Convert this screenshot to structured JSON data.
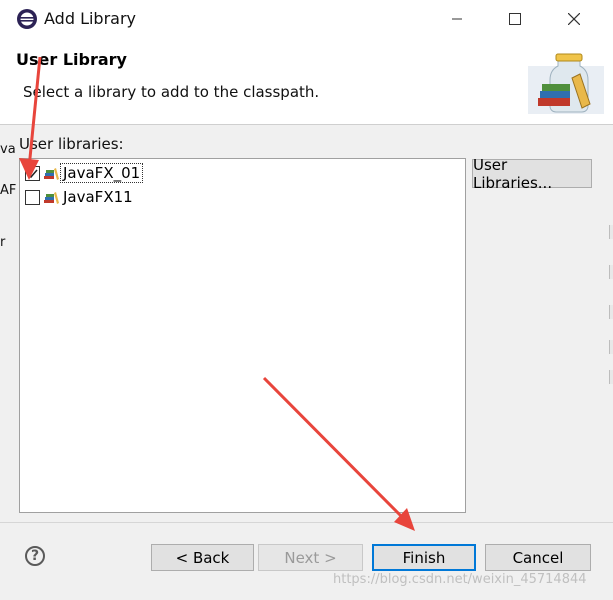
{
  "window": {
    "title": "Add Library",
    "minimize_icon": "minimize-icon",
    "maximize_icon": "maximize-icon",
    "close_icon": "close-icon"
  },
  "header": {
    "title": "User Library",
    "message": "Select a library to add to the classpath."
  },
  "list": {
    "label": "User libraries:",
    "items": [
      {
        "label": "JavaFX_01",
        "checked": true
      },
      {
        "label": "JavaFX11",
        "checked": false
      }
    ]
  },
  "side_button": {
    "label": "User Libraries..."
  },
  "footer": {
    "help_symbol": "?",
    "back_label": "< Back",
    "next_label": "Next >",
    "finish_label": "Finish",
    "cancel_label": "Cancel"
  },
  "watermark": "https://blog.csdn.net/weixin_45714844",
  "background_fragments": [
    "va",
    "AF",
    "r"
  ],
  "colors": {
    "accent": "#0078d7",
    "annotation_arrow": "#e8453c"
  }
}
